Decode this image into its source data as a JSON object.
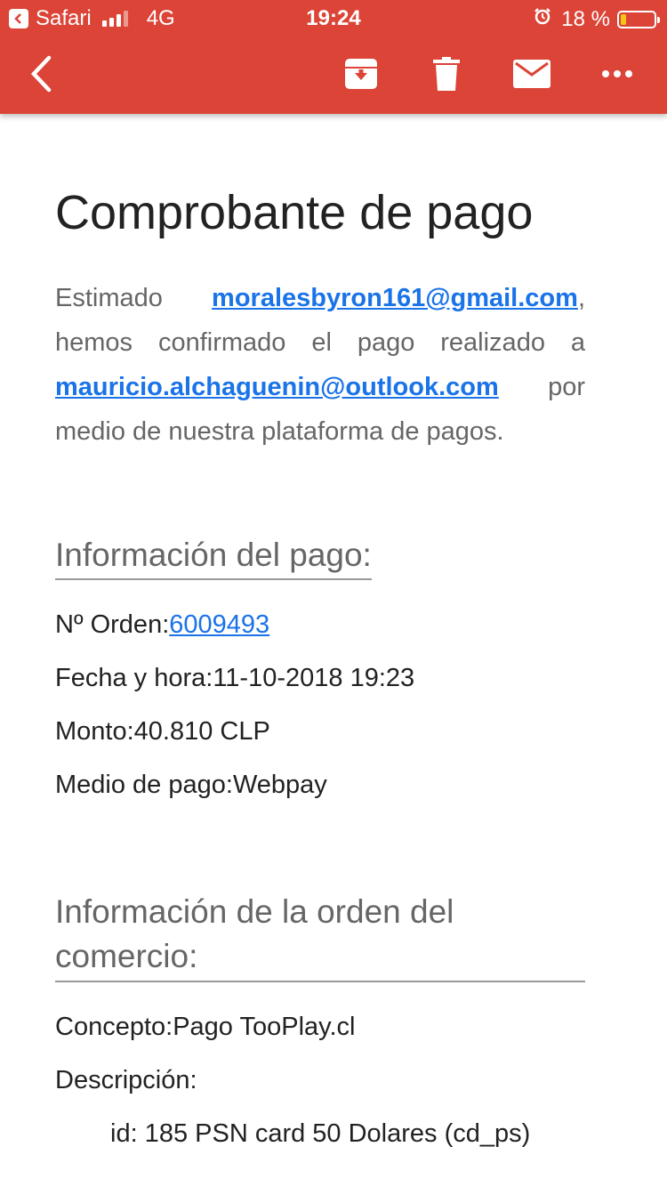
{
  "status_bar": {
    "app": "Safari",
    "network": "4G",
    "time": "19:24",
    "battery": "18 %",
    "battery_level": 0.18,
    "signal_bars_filled": 3,
    "signal_bars_total": 4
  },
  "toolbar": {
    "icons": [
      "back-arrow-icon",
      "archive-icon",
      "trash-icon",
      "mail-icon",
      "more-icon"
    ],
    "accent_color": "#db4437"
  },
  "email": {
    "title": "Comprobante de pago",
    "intro": {
      "greeting": "Estimado",
      "payer_email": "moralesbyron161@gmail.com",
      "text1": ", hemos confirmado el pago realizado a",
      "recipient_email": "mauricio.alchaguenin@outlook.com",
      "text2": "por medio de nuestra plataforma de pagos."
    },
    "payment_info": {
      "heading": "Información del pago:",
      "order_label": "Nº Orden:",
      "order_number": "6009493",
      "datetime_label": "Fecha y hora:",
      "datetime": "11-10-2018 19:23",
      "amount_label": "Monto:",
      "amount": "40.810 CLP",
      "method_label": "Medio de pago:",
      "method": "Webpay"
    },
    "order_info": {
      "heading": "Información de la orden del comercio:",
      "concept_label": "Concepto:",
      "concept": "Pago TooPlay.cl",
      "description_label": "Descripción:",
      "description_item": "id: 185 PSN card 50 Dolares (cd_ps)"
    }
  }
}
